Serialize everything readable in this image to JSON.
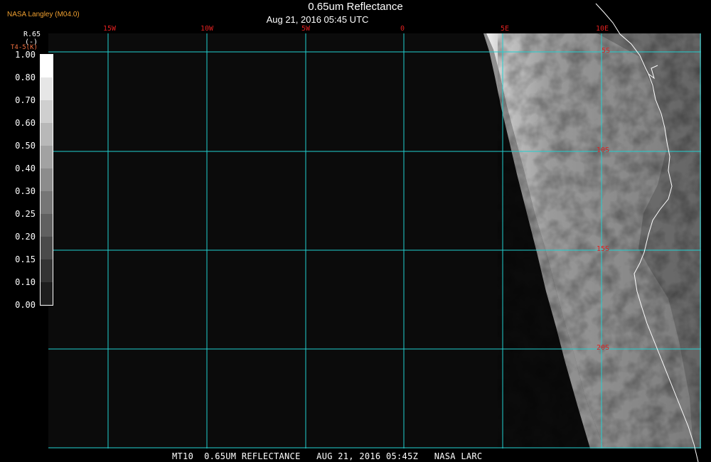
{
  "header": {
    "title": "0.65um Reflectance",
    "subtitle": "Aug 21, 2016 05:45 UTC",
    "credit": "NASA Langley (M04.0)"
  },
  "legend": {
    "title_line1": "R.65",
    "title_line2": "(-)",
    "subtitle": "T4-5(K)",
    "ticks": [
      "1.00",
      "0.80",
      "0.70",
      "0.60",
      "0.50",
      "0.40",
      "0.30",
      "0.25",
      "0.20",
      "0.15",
      "0.10",
      "0.00"
    ]
  },
  "map": {
    "longitude_labels": [
      "15W",
      "10W",
      "5W",
      "0",
      "5E",
      "10E"
    ],
    "latitude_labels": [
      "5S",
      "10S",
      "15S",
      "20S"
    ],
    "colors": {
      "grid": "#22d0d0",
      "coastline": "#ffffff",
      "labels": "#e02020"
    }
  },
  "footer": {
    "text": "MT10  0.65UM REFLECTANCE   AUG 21, 2016 05:45Z   NASA LARC"
  }
}
